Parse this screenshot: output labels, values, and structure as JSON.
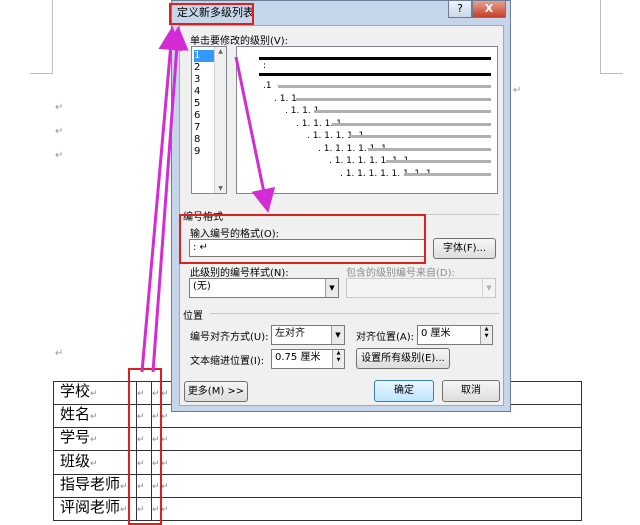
{
  "dialog": {
    "title": "定义新多级列表",
    "help_label": "?",
    "close_label": "X",
    "level_section_label": "单击要修改的级别(V):",
    "levels": [
      "1",
      "2",
      "3",
      "4",
      "5",
      "6",
      "7",
      "8",
      "9"
    ],
    "selected_level": "1",
    "preview_rows": [
      ":",
      ".1",
      ". 1. 1",
      ". 1. 1. 1",
      ". 1. 1. 1. 1",
      ". 1. 1. 1. 1. 1",
      ". 1. 1. 1. 1. 1. 1",
      ". 1. 1. 1. 1. 1. 1. 1",
      ". 1. 1. 1. 1. 1. 1. 1. 1"
    ],
    "number_format_group": "编号格式",
    "enter_format_label": "输入编号的格式(O):",
    "format_value": ": ↵",
    "font_button": "字体(F)...",
    "number_style_label": "此级别的编号样式(N):",
    "number_style_value": "(无)",
    "include_level_label": "包含的级别编号来自(D):",
    "include_level_value": "",
    "position_group": "位置",
    "alignment_label": "编号对齐方式(U):",
    "alignment_value": "左对齐",
    "align_at_label": "对齐位置(A):",
    "align_at_value": "0 厘米",
    "indent_label": "文本缩进位置(I):",
    "indent_value": "0.75 厘米",
    "set_all_button": "设置所有级别(E)...",
    "more_button": "更多(M) >>",
    "ok_button": "确定",
    "cancel_button": "取消"
  },
  "document": {
    "table_rows": [
      "学校",
      "姓名",
      "学号",
      "班级",
      "指导老师",
      "评阅老师"
    ],
    "return_mark": "↵"
  },
  "annotations": {
    "highlight_color": "#e02020",
    "arrow_color": "#d42bd4"
  }
}
